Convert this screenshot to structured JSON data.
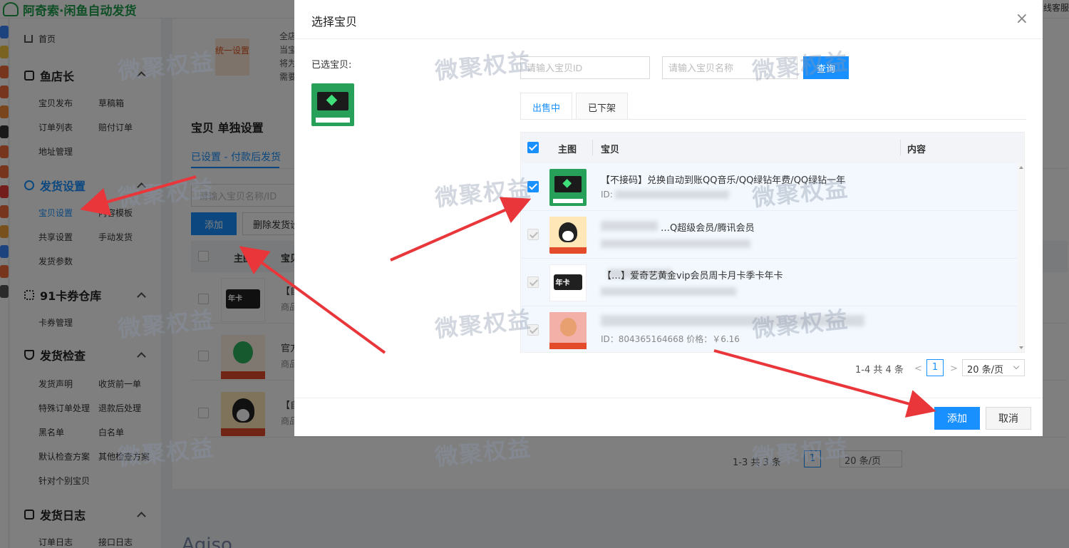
{
  "app": {
    "brand": "阿奇索·闲鱼自动发货",
    "top_right": "在线客服"
  },
  "sidebar": {
    "home": "首页",
    "groups": [
      {
        "title": "鱼店长",
        "items": [
          "宝贝发布",
          "草稿箱",
          "订单列表",
          "赔付订单",
          "地址管理"
        ]
      },
      {
        "title": "发货设置",
        "items": [
          "宝贝设置",
          "内容模板",
          "共享设置",
          "手动发货",
          "发货参数"
        ]
      },
      {
        "title": "91卡券仓库",
        "items": [
          "卡券管理"
        ]
      },
      {
        "title": "发货检查",
        "items": [
          "发货声明",
          "收货前一单",
          "特殊订单处理",
          "退款后处理",
          "黑名单",
          "白名单",
          "默认检查方案",
          "其他检查方案",
          "针对个别宝贝"
        ]
      },
      {
        "title": "发货日志",
        "items": [
          "订单日志",
          "接口日志"
        ]
      }
    ]
  },
  "background": {
    "unified_label": "统一设置",
    "blurb": [
      "全店",
      "当宝",
      "将为",
      "需要"
    ],
    "section_title": "宝贝  单独设置",
    "tab_active": "已设置 - 付款后发货",
    "search_placeholder": "请输入宝贝名称/ID",
    "add_button": "添加",
    "delete_button": "删除发货设置",
    "columns": [
      "主图",
      "宝贝"
    ],
    "rows": [
      {
        "t1": "【自",
        "t2": "商品"
      },
      {
        "t1": "官方",
        "t2": "商品"
      },
      {
        "t1": "【自",
        "t2": "商品"
      }
    ],
    "pager_total": "1-3 共 3 条",
    "pager_page": "1",
    "pager_size": "20 条/页",
    "footer_text": "Agiso"
  },
  "modal": {
    "title": "选择宝贝",
    "close": "×",
    "selected_label": "已选宝贝:",
    "id_placeholder": "请输入宝贝ID",
    "name_placeholder": "请输入宝贝名称",
    "query_button": "查询",
    "tabs": [
      "出售中",
      "已下架"
    ],
    "columns": {
      "image": "主图",
      "item": "宝贝",
      "content": "内容"
    },
    "rows": [
      {
        "title": "【不接码】兑换自动到账QQ音乐/QQ绿钻年费/QQ绿钻一年",
        "sub": "ID:",
        "checked": true
      },
      {
        "title": "…Q超级会员/腾讯会员",
        "sub": "",
        "checked": false
      },
      {
        "title": "【…】爱奇艺黄金vip会员周卡月卡季卡年卡",
        "sub": "",
        "checked": false
      },
      {
        "title": "",
        "sub": "ID：804365164668  价格：￥6.16",
        "checked": false
      }
    ],
    "pager_total": "1-4 共 4 条",
    "pager_prev": "<",
    "pager_next": ">",
    "pager_page": "1",
    "pager_size": "20 条/页",
    "add_button": "添加",
    "cancel_button": "取消"
  },
  "watermark": "微聚权益",
  "colors": {
    "primary": "#1890ff",
    "brand_green": "#1e9e4a",
    "arrow_red": "#e8363a"
  }
}
